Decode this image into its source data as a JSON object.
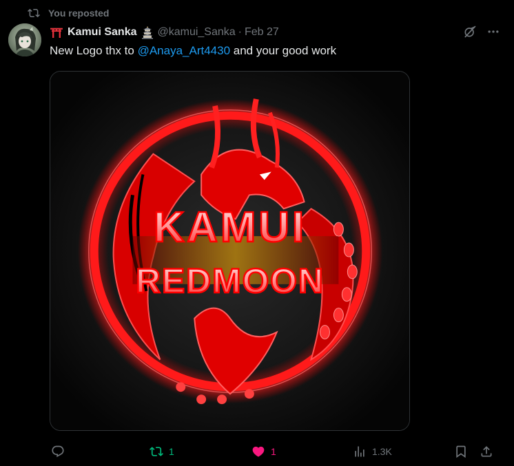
{
  "repost": {
    "label": "You reposted",
    "icon": "repost-icon"
  },
  "tweet": {
    "author_name": "Kamui Sanka",
    "name_prefix_emoji": "torii-gate-emoji",
    "name_suffix_emoji": "pagoda-emoji",
    "handle": "@kamui_Sanka",
    "separator": "·",
    "date": "Feb 27",
    "text_before": "New Logo thx to ",
    "mention": "@Anaya_Art4430",
    "text_after": " and your good work",
    "image": {
      "logo_line1": "KAMUI",
      "logo_line2": "REDMOON"
    }
  },
  "top_actions": {
    "grok_icon": "grok-icon",
    "more_icon": "more-icon"
  },
  "actions": {
    "reply_icon": "reply-icon",
    "repost_count": "1",
    "like_count": "1",
    "views_count": "1.3K",
    "bookmark_icon": "bookmark-icon",
    "share_icon": "share-icon"
  },
  "colors": {
    "background": "#000000",
    "text": "#e7e9ea",
    "muted": "#71767b",
    "mention": "#1d9bf0",
    "repost_active": "#00ba7c",
    "like_active": "#f91880",
    "logo_red": "#ff1a1a"
  }
}
